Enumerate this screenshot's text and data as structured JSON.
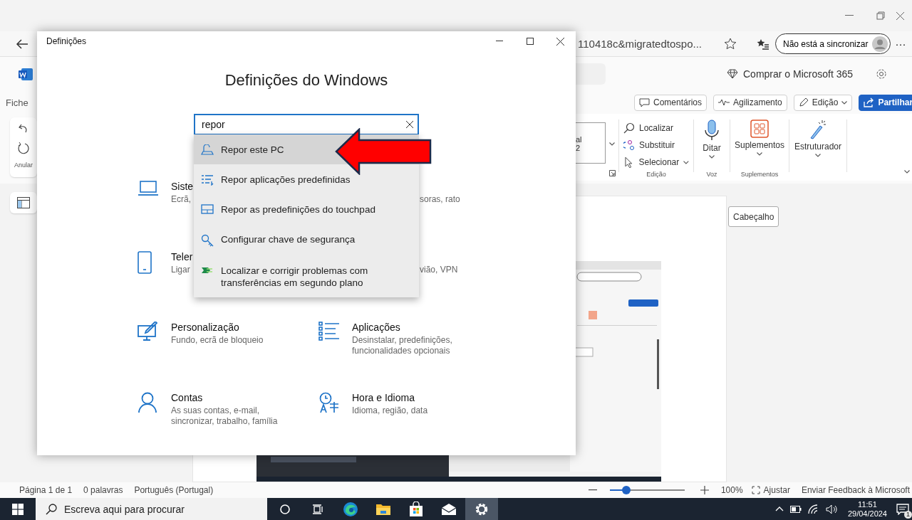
{
  "browser": {
    "address": "110418c&migratedtospo...",
    "sync_button": "Não está a sincronizar",
    "more_button": "···"
  },
  "word": {
    "file_tab": "Fiche",
    "buy_link": "Comprar o Microsoft 365",
    "actions": [
      {
        "label": "Comentários",
        "kind": "comment"
      },
      {
        "label": "Agilizamento",
        "kind": "catchup"
      },
      {
        "label": "Edição",
        "kind": "mode"
      },
      {
        "label": "Partilhar",
        "kind": "share"
      }
    ],
    "undo_label": "Anular",
    "style_preview": [
      "al",
      "2"
    ],
    "editing": {
      "items": [
        {
          "label": "Localizar",
          "dropdown": false
        },
        {
          "label": "Substituir",
          "dropdown": false
        },
        {
          "label": "Selecionar",
          "dropdown": true
        }
      ],
      "group": "Edição"
    },
    "dictate": {
      "label": "Ditar",
      "group": "Voz"
    },
    "addins": {
      "label": "Suplementos",
      "group": "Suplementos"
    },
    "designer": {
      "label": "Estruturador"
    }
  },
  "document": {
    "header_button": "Cabeçalho"
  },
  "status_bar": {
    "items": [
      "Página 1 de 1",
      "0 palavras",
      "Português (Portugal)"
    ],
    "zoom": {
      "level": 0.22,
      "reading": "100%"
    },
    "fit": "Ajustar",
    "feedback": "Enviar Feedback à Microsoft"
  },
  "settings": {
    "title": "Definições",
    "heading": "Definições do Windows",
    "search": {
      "value": "repor"
    },
    "results": [
      {
        "label": "Repor este PC",
        "selected": true
      },
      {
        "label": "Repor aplicações predefinidas",
        "selected": false
      },
      {
        "label": "Repor as predefinições do touchpad",
        "selected": false
      },
      {
        "label": "Configurar chave de segurança",
        "selected": false
      },
      {
        "label": "Localizar e corrigir problemas com transferências em segundo plano",
        "selected": false
      }
    ],
    "tiles": [
      {
        "kind": "tile",
        "title": "Siste",
        "description": "Ecrã,"
      },
      {
        "kind": "cut",
        "description": "soras, rato"
      },
      {
        "kind": "tile",
        "title": "Teler",
        "description": "Ligar"
      },
      {
        "kind": "cut",
        "description": "vião, VPN"
      },
      {
        "kind": "tile",
        "title": "Personalização",
        "description": "Fundo, ecrã de bloqueio"
      },
      {
        "kind": "tile",
        "title": "Aplicações",
        "description": "Desinstalar, predefinições, funcionalidades opcionais"
      },
      {
        "kind": "tile",
        "title": "Contas",
        "description": "As suas contas, e-mail, sincronizar, trabalho, família"
      },
      {
        "kind": "tile",
        "title": "Hora e Idioma",
        "description": "Idioma, região, data"
      }
    ]
  },
  "taskbar": {
    "search": {
      "placeholder": "Escreva aqui para procurar"
    },
    "apps": [
      {
        "kind": "cortana",
        "selected": false
      },
      {
        "kind": "taskview",
        "selected": false
      },
      {
        "kind": "edge",
        "selected": false
      },
      {
        "kind": "explorer",
        "selected": false
      },
      {
        "kind": "store",
        "selected": false
      },
      {
        "kind": "mail",
        "selected": false
      },
      {
        "kind": "settings",
        "selected": true
      }
    ],
    "time": "11:51",
    "date": "29/04/2024",
    "notifications": "1"
  }
}
